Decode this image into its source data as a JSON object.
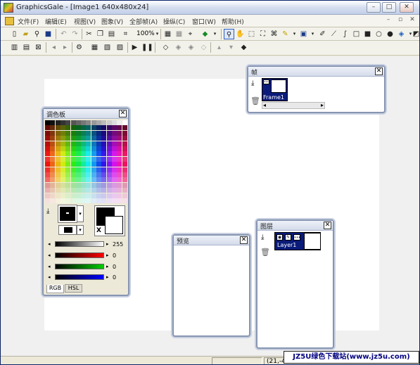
{
  "window": {
    "title": "GraphicsGale - [Image1 640x480x24]",
    "min_symbol": "–",
    "max_symbol": "□",
    "close_symbol": "✕"
  },
  "menu": {
    "items": [
      "文件(F)",
      "编辑(E)",
      "视图(V)",
      "图象(V)",
      "全部帧(A)",
      "操纵(C)",
      "窗口(W)",
      "帮助(H)"
    ],
    "mdi_min": "–",
    "mdi_max": "▫",
    "mdi_close": "✕"
  },
  "toolbar": {
    "zoom_value": "100%"
  },
  "frames_panel": {
    "title": "帧",
    "close": "✕",
    "frame_label": "Frame1",
    "frame_dots": "•••",
    "scroll_left": "◂",
    "scroll_right": "▸"
  },
  "palette_panel": {
    "title": "调色板",
    "close": "✕",
    "swap_label": "X",
    "tabs": [
      "RGB",
      "HSL"
    ],
    "sliders": [
      {
        "name": "gray",
        "value": "255"
      },
      {
        "name": "red",
        "value": "0"
      },
      {
        "name": "green",
        "value": "0"
      },
      {
        "name": "blue",
        "value": "0"
      }
    ]
  },
  "preview_panel": {
    "title": "预览",
    "close": "✕"
  },
  "layers_panel": {
    "title": "图层",
    "close": "✕",
    "layer_label": "Layer1",
    "layer_dots": "•••"
  },
  "status": {
    "coords": "(21,-4)"
  },
  "watermark": {
    "text": "JZ5U绿色下载站(www.jz5u.com)"
  },
  "colors": {
    "selection_blue": "#0a1b7a",
    "panel_border": "#8795b2"
  }
}
